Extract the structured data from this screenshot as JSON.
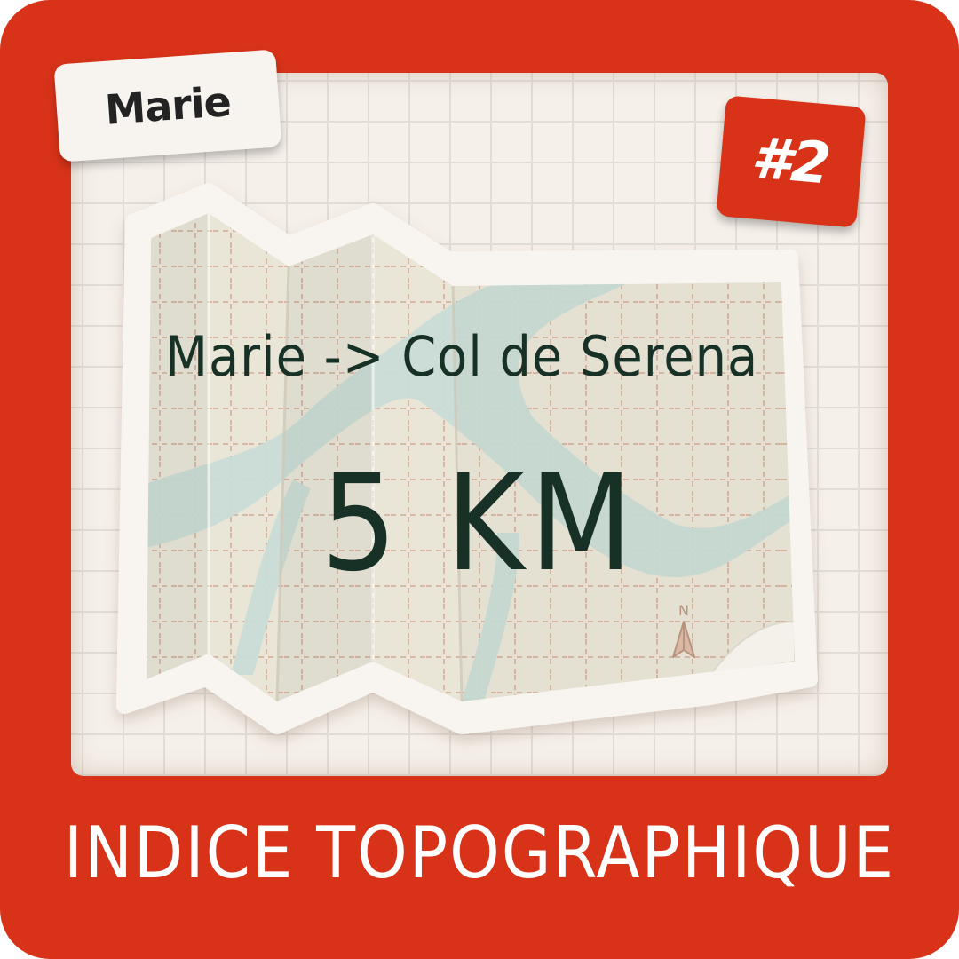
{
  "card": {
    "player_name": "Marie",
    "clue_number": "#2",
    "route": "Marie -> Col de Serena",
    "distance": "5 KM",
    "title": "INDICE TOPOGRAPHIQUE",
    "compass_label": "N"
  },
  "colors": {
    "frame": "#d83319",
    "paper": "#f6f0ea",
    "map": "#e9e6d8",
    "river": "#c9dcd6",
    "text_dark": "#173127",
    "text_light": "#ffffff"
  },
  "icons": {
    "map": "folded-map-icon",
    "compass": "north-arrow-icon"
  }
}
